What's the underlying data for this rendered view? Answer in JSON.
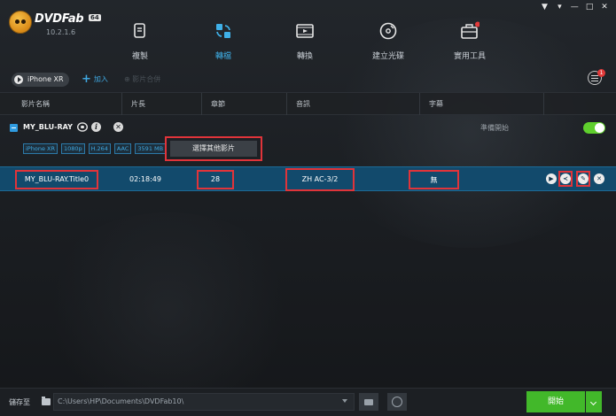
{
  "window": {
    "brand": "DVDFab",
    "edition": "64",
    "version": "10.2.1.6",
    "controls": [
      "▼",
      "▾",
      "—",
      "□",
      "✕"
    ]
  },
  "modules": [
    {
      "label": "複製",
      "icon": "copy-icon",
      "active": false
    },
    {
      "label": "轉檔",
      "icon": "ripper-icon",
      "active": true
    },
    {
      "label": "轉換",
      "icon": "video-converter-icon",
      "active": false
    },
    {
      "label": "建立光碟",
      "icon": "creator-disc-icon",
      "active": false
    },
    {
      "label": "實用工具",
      "icon": "utility-toolbox-icon",
      "active": false
    }
  ],
  "toolbar": {
    "profile": "iPhone XR",
    "add": "加入",
    "merge": "影片合併",
    "task_badge": "1"
  },
  "columns": [
    "影片名稱",
    "片長",
    "章節",
    "音訊",
    "字幕"
  ],
  "source": {
    "name": "MY_BLU-RAY",
    "status": "準備開始",
    "tags": [
      "iPhone XR",
      "1080p",
      "H.264",
      "AAC",
      "3591 MB"
    ],
    "info_glyph": "i",
    "remove_glyph": "✕",
    "other_titles_button": "選擇其他影片"
  },
  "title_row": {
    "name": "MY_BLU-RAY.Title0",
    "duration": "02:18:49",
    "chapters": "28",
    "audio": "ZH AC-3/2",
    "subtitle": "無",
    "icon_glyphs": {
      "play": "▶",
      "advanced": "≺",
      "edit": "✎",
      "remove": "✕"
    }
  },
  "footer": {
    "save_label": "儲存至",
    "path": "C:\\Users\\HP\\Documents\\DVDFab10\\",
    "start": "開始"
  },
  "colors": {
    "accent_blue": "#3fb0e8",
    "selected_row": "#124a6c",
    "highlight_box": "#e0343a",
    "start_green": "#42b82a",
    "toggle_green": "#5fcf2d"
  }
}
